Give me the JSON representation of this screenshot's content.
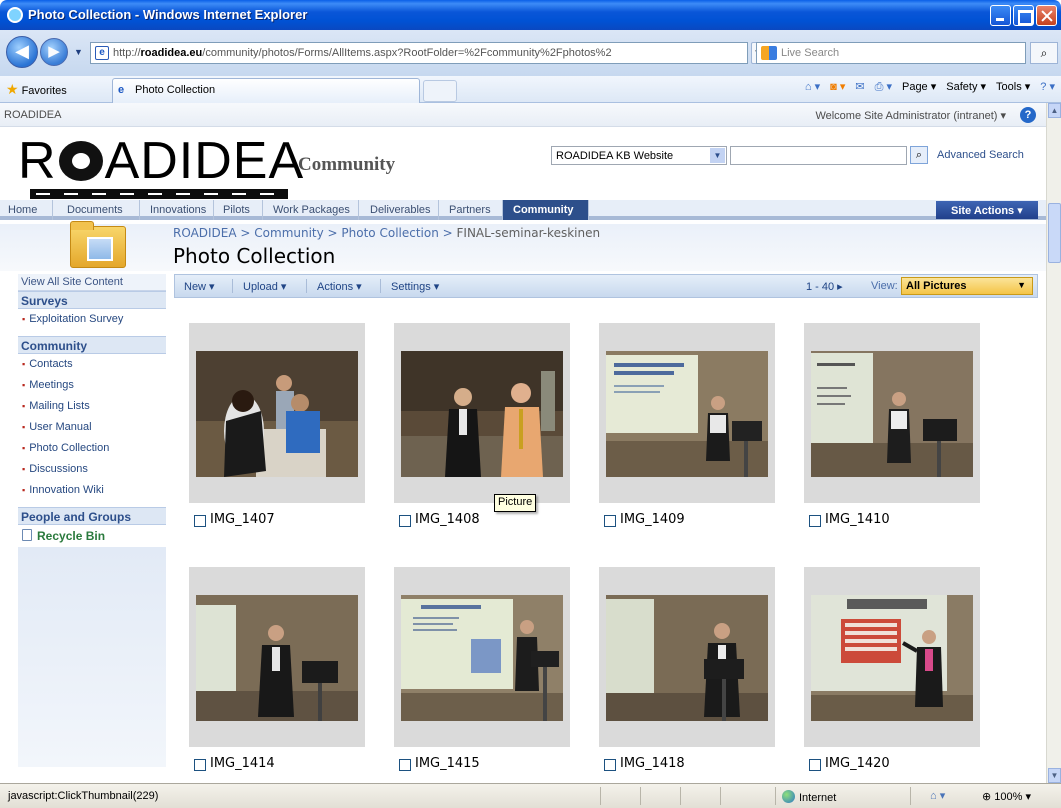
{
  "window": {
    "title": "Photo Collection - Windows Internet Explorer"
  },
  "browser": {
    "url_prefix": "http://",
    "url_host": "roadidea.eu",
    "url_path": "/community/photos/Forms/AllItems.aspx?RootFolder=%2Fcommunity%2Fphotos%2",
    "search_placeholder": "Live Search",
    "favorites_label": "Favorites",
    "tab_title": "Photo Collection",
    "cmd_page": "Page ▾",
    "cmd_safety": "Safety ▾",
    "cmd_tools": "Tools ▾"
  },
  "site": {
    "name": "ROADIDEA",
    "welcome": "Welcome Site Administrator (intranet) ▾",
    "logo_text_left": "R",
    "logo_text_right": "ADIDEA",
    "logo_sub": "Community",
    "search_scope": "ROADIDEA KB Website",
    "advanced_search": "Advanced Search"
  },
  "topnav": {
    "items": [
      "Home",
      "Documents",
      "Innovations",
      "Pilots",
      "Work Packages",
      "Deliverables",
      "Partners",
      "Community"
    ],
    "selected": "Community",
    "site_actions": "Site Actions ▾"
  },
  "breadcrumb": {
    "root": "ROADIDEA",
    "sep": " > ",
    "community": "Community",
    "photo_collection": "Photo Collection",
    "current": "FINAL-seminar-keskinen"
  },
  "page_title": "Photo Collection",
  "leftnav": {
    "view_all": "View All Site Content",
    "surveys_header": "Surveys",
    "surveys": [
      "Exploitation Survey"
    ],
    "community_header": "Community",
    "community": [
      "Contacts",
      "Meetings",
      "Mailing Lists",
      "User Manual",
      "Photo Collection",
      "Discussions",
      "Innovation Wiki"
    ],
    "people_header": "People and Groups",
    "recycle_bin": "Recycle Bin"
  },
  "toolbar": {
    "new": "New ▾",
    "upload": "Upload ▾",
    "actions": "Actions ▾",
    "settings": "Settings ▾",
    "range": "1 - 40 ▸",
    "view_label": "View:",
    "view_value": "All Pictures"
  },
  "photos": [
    {
      "name": "IMG_1407"
    },
    {
      "name": "IMG_1408"
    },
    {
      "name": "IMG_1409"
    },
    {
      "name": "IMG_1410"
    },
    {
      "name": "IMG_1414"
    },
    {
      "name": "IMG_1415"
    },
    {
      "name": "IMG_1418"
    },
    {
      "name": "IMG_1420"
    }
  ],
  "tooltip": "Picture",
  "status": {
    "message": "javascript:ClickThumbnail(229)",
    "zone": "Internet",
    "zoom": "100%"
  }
}
